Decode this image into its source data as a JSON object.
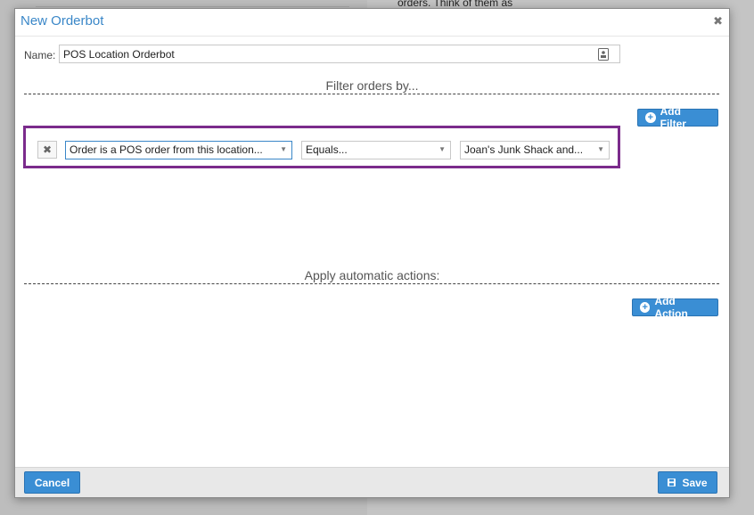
{
  "background": {
    "text": "orders. Think of them as"
  },
  "modal": {
    "title": "New Orderbot",
    "close_icon": "close-x-icon"
  },
  "name_field": {
    "label": "Name:",
    "value": "POS Location Orderbot",
    "icon": "contact-card-icon"
  },
  "filter_section": {
    "heading": "Filter orders by...",
    "add_button_label": "Add Filter",
    "add_icon": "plus-circle-icon",
    "filters": [
      {
        "remove_icon": "close-x-icon",
        "field": "Order is a POS order from this location...",
        "operator": "Equals...",
        "value": "Joan's Junk Shack and..."
      }
    ]
  },
  "action_section": {
    "heading": "Apply automatic actions:",
    "add_button_label": "Add Action",
    "add_icon": "plus-circle-icon"
  },
  "footer": {
    "cancel_label": "Cancel",
    "save_label": "Save",
    "save_icon": "floppy-disk-icon"
  },
  "colors": {
    "accent": "#3a8ed4",
    "highlight_border": "#7b2b8c",
    "title_text": "#3a87c8"
  }
}
